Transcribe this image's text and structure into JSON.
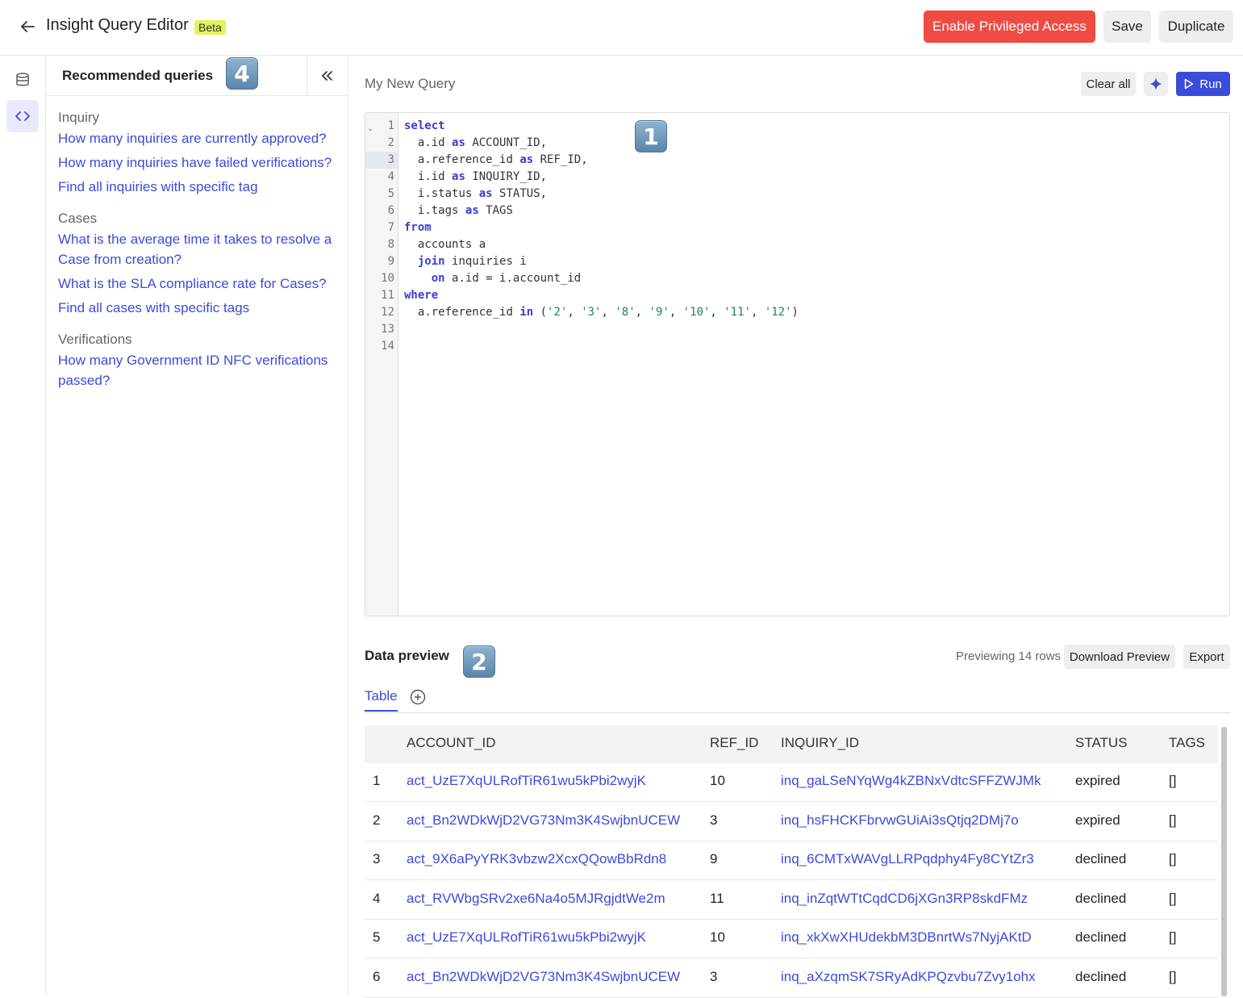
{
  "header": {
    "title": "Insight Query Editor",
    "badge": "Beta",
    "buttons": {
      "privileged": "Enable Privileged Access",
      "save": "Save",
      "duplicate": "Duplicate"
    }
  },
  "rail": {
    "icons": [
      "database-icon",
      "code-icon"
    ]
  },
  "sidebar": {
    "title": "Recommended queries",
    "sections": [
      {
        "name": "Inquiry",
        "links": [
          "How many inquiries are currently approved?",
          "How many inquiries have failed verifications?",
          "Find all inquiries with specific tag"
        ]
      },
      {
        "name": "Cases",
        "links": [
          "What is the average time it takes to resolve a Case from creation?",
          "What is the SLA compliance rate for Cases?",
          "Find all cases with specific tags"
        ]
      },
      {
        "name": "Verifications",
        "links": [
          "How many Government ID NFC verifications passed?"
        ]
      }
    ]
  },
  "markers": {
    "editor": "1",
    "preview": "2",
    "sidebar": "4"
  },
  "query": {
    "name": "My New Query",
    "clear_label": "Clear all",
    "run_label": "Run",
    "line_numbers": [
      "1",
      "2",
      "3",
      "4",
      "5",
      "6",
      "7",
      "8",
      "9",
      "10",
      "11",
      "12",
      "13",
      "14"
    ],
    "lines": [
      "select",
      "  a.id as ACCOUNT_ID,",
      "  a.reference_id as REF_ID,",
      "  i.id as INQUIRY_ID,",
      "  i.status as STATUS,",
      "  i.tags as TAGS",
      "from",
      "  accounts a",
      "  join inquiries i",
      "    on a.id = i.account_id",
      "where",
      "  a.reference_id in ('2', '3', '8', '9', '10', '11', '12')",
      "",
      ""
    ]
  },
  "preview": {
    "title": "Data preview",
    "info": "Previewing 14 rows",
    "download_label": "Download Preview",
    "export_label": "Export",
    "tab_label": "Table",
    "columns": [
      "ACCOUNT_ID",
      "REF_ID",
      "INQUIRY_ID",
      "STATUS",
      "TAGS"
    ],
    "rows": [
      [
        "1",
        "act_UzE7XqULRofTiR61wu5kPbi2wyjK",
        "10",
        "inq_gaLSeNYqWg4kZBNxVdtcSFFZWJMk",
        "expired",
        "[]"
      ],
      [
        "2",
        "act_Bn2WDkWjD2VG73Nm3K4SwjbnUCEW",
        "3",
        "inq_hsFHCKFbrvwGUiAi3sQtjq2DMj7o",
        "expired",
        "[]"
      ],
      [
        "3",
        "act_9X6aPyYRK3vbzw2XcxQQowBbRdn8",
        "9",
        "inq_6CMTxWAVgLLRPqdphy4Fy8CYtZr3",
        "declined",
        "[]"
      ],
      [
        "4",
        "act_RVWbgSRv2xe6Na4o5MJRgjdtWe2m",
        "11",
        "inq_inZqtWTtCqdCD6jXGn3RP8skdFMz",
        "declined",
        "[]"
      ],
      [
        "5",
        "act_UzE7XqULRofTiR61wu5kPbi2wyjK",
        "10",
        "inq_xkXwXHUdekbM3DBnrtWs7NyjAKtD",
        "declined",
        "[]"
      ],
      [
        "6",
        "act_Bn2WDkWjD2VG73Nm3K4SwjbnUCEW",
        "3",
        "inq_aXzqmSK7SRyAdKPQzvbu7Zvy1ohx",
        "declined",
        "[]"
      ]
    ]
  },
  "colors": {
    "accent": "#3b4bdb",
    "danger": "#ef4b43",
    "beta": "#e3f35a"
  }
}
